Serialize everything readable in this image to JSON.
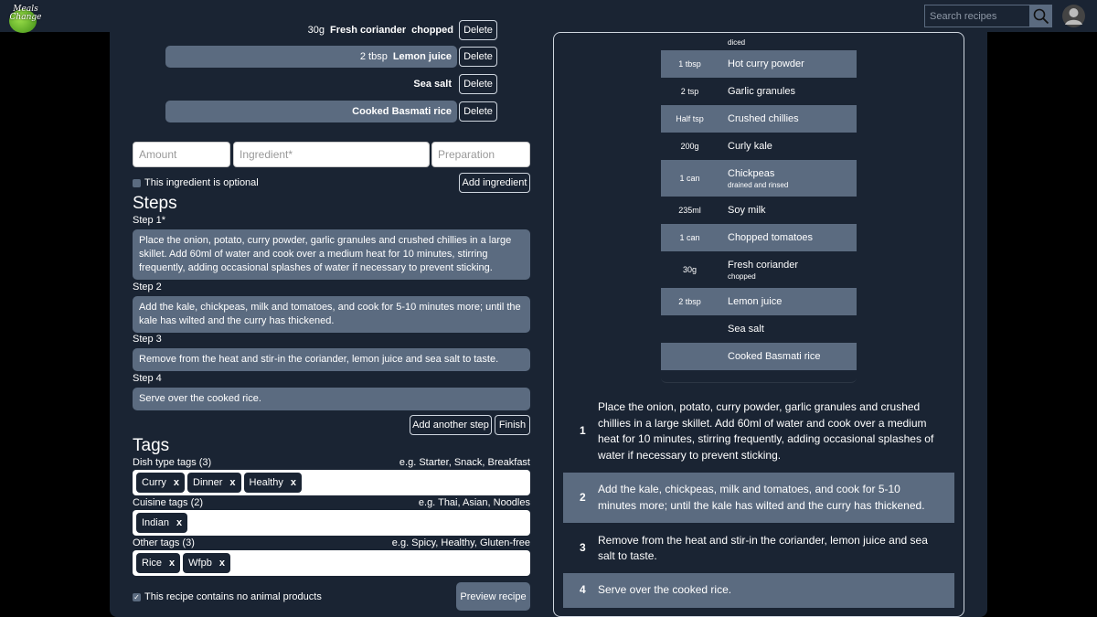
{
  "header": {
    "logo_text_1": "Meals",
    "logo_text_2": "Change",
    "search_placeholder": "Search recipes"
  },
  "ingredients": [
    {
      "amount": "30g",
      "name": "Fresh coriander",
      "prep": "chopped",
      "delete": "Delete"
    },
    {
      "amount": "2 tbsp",
      "name": "Lemon juice",
      "prep": "",
      "delete": "Delete"
    },
    {
      "amount": "",
      "name": "Sea salt",
      "prep": "",
      "delete": "Delete"
    },
    {
      "amount": "",
      "name": "Cooked Basmati rice",
      "prep": "",
      "delete": "Delete"
    }
  ],
  "new_ingredient": {
    "amount_placeholder": "Amount",
    "ingredient_placeholder": "Ingredient*",
    "prep_placeholder": "Preparation",
    "optional_label": "This ingredient is optional",
    "add_button": "Add ingredient"
  },
  "steps_section": {
    "heading": "Steps",
    "steps": [
      {
        "label": "Step 1*",
        "text": "Place the onion, potato, curry powder, garlic granules and crushed chillies in a large skillet. Add 60ml of water and cook over a medium heat for 10 minutes, stirring frequently, adding occasional splashes of water if necessary to prevent sticking."
      },
      {
        "label": "Step 2",
        "text": "Add the kale, chickpeas, milk and tomatoes, and cook for 5-10 minutes more; until the kale has wilted and the curry has thickened."
      },
      {
        "label": "Step 3",
        "text": "Remove from the heat and stir-in the coriander, lemon juice and sea salt to taste."
      },
      {
        "label": "Step 4",
        "text": "Serve over the cooked rice."
      }
    ],
    "add_step_button": "Add another step",
    "finish_button": "Finish"
  },
  "tags_section": {
    "heading": "Tags",
    "dish": {
      "label": "Dish type tags (3)",
      "hint": "e.g. Starter, Snack, Breakfast",
      "tags": [
        "Curry",
        "Dinner",
        "Healthy"
      ]
    },
    "cuisine": {
      "label": "Cuisine tags (2)",
      "hint": "e.g. Thai, Asian, Noodles",
      "tags": [
        "Indian"
      ]
    },
    "other": {
      "label": "Other tags (3)",
      "hint": "e.g. Spicy, Healthy, Gluten-free",
      "tags": [
        "Rice",
        "Wfpb"
      ]
    },
    "remove_symbol": "x"
  },
  "footer": {
    "vegan_label": "This recipe contains no animal products",
    "preview_button": "Preview recipe"
  },
  "preview": {
    "top_partial_prep": "diced",
    "ingredients": [
      {
        "amount": "1 tbsp",
        "name": "Hot curry powder",
        "prep": ""
      },
      {
        "amount": "2 tsp",
        "name": "Garlic granules",
        "prep": ""
      },
      {
        "amount": "Half tsp",
        "name": "Crushed chillies",
        "prep": ""
      },
      {
        "amount": "200g",
        "name": "Curly kale",
        "prep": ""
      },
      {
        "amount": "1 can",
        "name": "Chickpeas",
        "prep": "drained and rinsed"
      },
      {
        "amount": "235ml",
        "name": "Soy milk",
        "prep": ""
      },
      {
        "amount": "1 can",
        "name": "Chopped tomatoes",
        "prep": ""
      },
      {
        "amount": "30g",
        "name": "Fresh coriander",
        "prep": "chopped"
      },
      {
        "amount": "2 tbsp",
        "name": "Lemon juice",
        "prep": ""
      },
      {
        "amount": "",
        "name": "Sea salt",
        "prep": ""
      },
      {
        "amount": "",
        "name": "Cooked Basmati rice",
        "prep": ""
      }
    ],
    "steps": [
      {
        "num": "1",
        "text": "Place the onion, potato, curry powder, garlic granules and crushed chillies in a large skillet. Add 60ml of water and cook over a medium heat for 10 minutes, stirring frequently, adding occasional splashes of water if necessary to prevent sticking."
      },
      {
        "num": "2",
        "text": "Add the kale, chickpeas, milk and tomatoes, and cook for 5-10 minutes more; until the kale has wilted and the curry has thickened."
      },
      {
        "num": "3",
        "text": "Remove from the heat and stir-in the coriander, lemon juice and sea salt to taste."
      },
      {
        "num": "4",
        "text": "Serve over the cooked rice."
      }
    ]
  },
  "colors": {
    "background": "#1a2433",
    "accent": "#5b6b80",
    "page": "#000000"
  }
}
